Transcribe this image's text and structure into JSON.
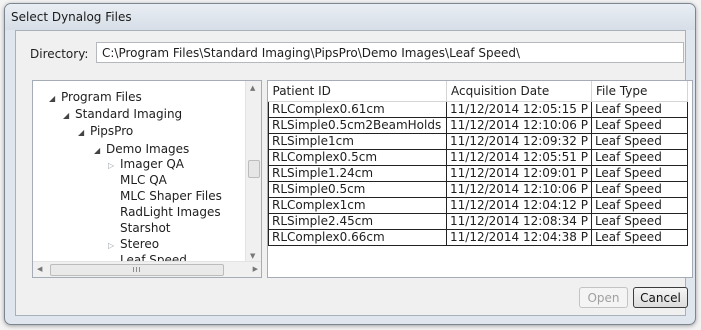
{
  "window": {
    "title": "Select Dynalog Files"
  },
  "directory": {
    "label": "Directory:",
    "value": "C:\\Program Files\\Standard Imaging\\PipsPro\\Demo Images\\Leaf Speed\\"
  },
  "tree": {
    "items": [
      {
        "label": "Program Files",
        "expander": "expanded"
      },
      {
        "label": "Standard Imaging",
        "expander": "expanded"
      },
      {
        "label": "PipsPro",
        "expander": "expanded"
      },
      {
        "label": "Demo Images",
        "expander": "expanded"
      },
      {
        "label": "Imager QA",
        "expander": "collapsed"
      },
      {
        "label": "MLC QA",
        "expander": "none"
      },
      {
        "label": "MLC Shaper Files",
        "expander": "none"
      },
      {
        "label": "RadLight Images",
        "expander": "none"
      },
      {
        "label": "Starshot",
        "expander": "none"
      },
      {
        "label": "Stereo",
        "expander": "collapsed"
      },
      {
        "label": "Leaf Speed",
        "expander": "none"
      }
    ],
    "scroll_thumb_grip": "III"
  },
  "files": {
    "columns": [
      "Patient ID",
      "Acquisition Date",
      "File Type"
    ],
    "rows": [
      [
        "RLComplex0.61cm",
        "11/12/2014 12:05:15 P",
        "Leaf Speed"
      ],
      [
        "RLSimple0.5cm2BeamHolds",
        "11/12/2014 12:10:06 P",
        "Leaf Speed"
      ],
      [
        "RLSimple1cm",
        "11/12/2014 12:09:32 P",
        "Leaf Speed"
      ],
      [
        "RLComplex0.5cm",
        "11/12/2014 12:05:51 P",
        "Leaf Speed"
      ],
      [
        "RLSimple1.24cm",
        "11/12/2014 12:09:01 P",
        "Leaf Speed"
      ],
      [
        "RLSimple0.5cm",
        "11/12/2014 12:10:06 P",
        "Leaf Speed"
      ],
      [
        "RLComplex1cm",
        "11/12/2014 12:04:12 P",
        "Leaf Speed"
      ],
      [
        "RLSimple2.45cm",
        "11/12/2014 12:08:34 P",
        "Leaf Speed"
      ],
      [
        "RLComplex0.66cm",
        "11/12/2014 12:04:38 P",
        "Leaf Speed"
      ]
    ]
  },
  "buttons": {
    "open": "Open",
    "cancel": "Cancel"
  },
  "colors": {
    "window_frame": "#dfe6ee",
    "client": "#f0f0f0",
    "open_disabled_text": "#a0a0a0"
  }
}
